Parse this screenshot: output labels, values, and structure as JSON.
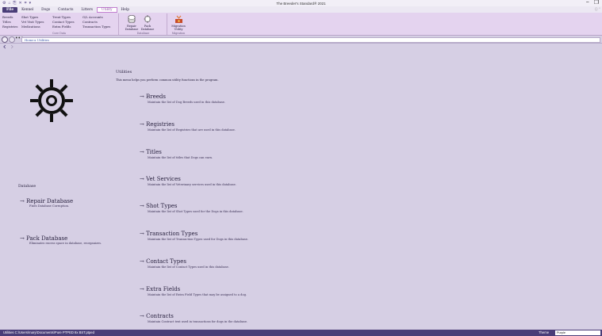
{
  "window": {
    "title": "The Breeder's Standard® 2021",
    "help_end": "ⓘ ˇ",
    "quick_access": [
      "⚙",
      "⌂",
      "⎘",
      "✕",
      "⌗",
      "▾"
    ],
    "minimize": "−",
    "restore": "❐"
  },
  "menu": [
    "File",
    "Kennel",
    "Dogs",
    "Contacts",
    "Litters",
    "Utility",
    "Help"
  ],
  "ribbon": {
    "core_data": {
      "col1": [
        "Breeds",
        "Titles",
        "Registries"
      ],
      "col2": [
        "Shot Types",
        "Vet Visit Types",
        "Medications"
      ],
      "col3": [
        "Treat Types",
        "Contact Types",
        "Extra Fields"
      ],
      "col4": [
        "G/L Accounts",
        "Contracts",
        "Transaction Types"
      ],
      "label": "Core Data"
    },
    "database": {
      "repair": [
        "Repair",
        "Database"
      ],
      "pack": [
        "Pack",
        "Database"
      ],
      "label": "Database"
    },
    "migration": {
      "button": [
        "Migration",
        "Utility"
      ],
      "label": "Migration"
    }
  },
  "breadcrumb": {
    "more": "•••",
    "home": "Home",
    "separator": "▸",
    "current": "Utilities"
  },
  "page": {
    "title": "Utilities",
    "description": "This menu helps you perform common utility functions in the program."
  },
  "database_section": {
    "header": "Database",
    "items": [
      {
        "title": "Repair Database",
        "desc": "Fixes Database Corruption."
      },
      {
        "title": "Pack Database",
        "desc": "Eliminates excess space in database, reorganizes."
      }
    ]
  },
  "utilities": [
    {
      "title": "Breeds",
      "desc": "Maintain the list of Dog Breeds used in this database."
    },
    {
      "title": "Registries",
      "desc": "Maintain the list of Registries that are used in this database."
    },
    {
      "title": "Titles",
      "desc": "Maintain the list of titles that Dogs can earn."
    },
    {
      "title": "Vet Services",
      "desc": "Maintain the list of Veterinary services used in this database."
    },
    {
      "title": "Shot Types",
      "desc": "Maintain the list of Shot Types used for the Dogs in this database."
    },
    {
      "title": "Transaction Types",
      "desc": "Maintain the list of Transaction Types used for Dogs in this database."
    },
    {
      "title": "Contact Types",
      "desc": "Maintain the list of Contact Types used in this database."
    },
    {
      "title": "Extra Fields",
      "desc": "Maintain the list of Extra Field Types that may be assigned to a dog."
    },
    {
      "title": "Contracts",
      "desc": "Maintain Contract text used in transactions for dogs in the database."
    }
  ],
  "arrow": "→",
  "status": {
    "text": "Utilities   C:\\Users\\mary\\Documents\\Pure PTPED 8x BST.ptped",
    "theme_label": "Theme",
    "theme_value": "Purple"
  },
  "colors": {
    "accent": "#4a3d78",
    "ribbon": "#e4d3ef",
    "background": "#d6cfe4",
    "active_tab": "#8b4aa0"
  },
  "icons": {
    "gear": "gear-icon",
    "repair": "database-repair-icon",
    "pack": "database-pack-icon",
    "migration": "migration-icon",
    "back": "back-icon",
    "forward": "forward-icon"
  }
}
